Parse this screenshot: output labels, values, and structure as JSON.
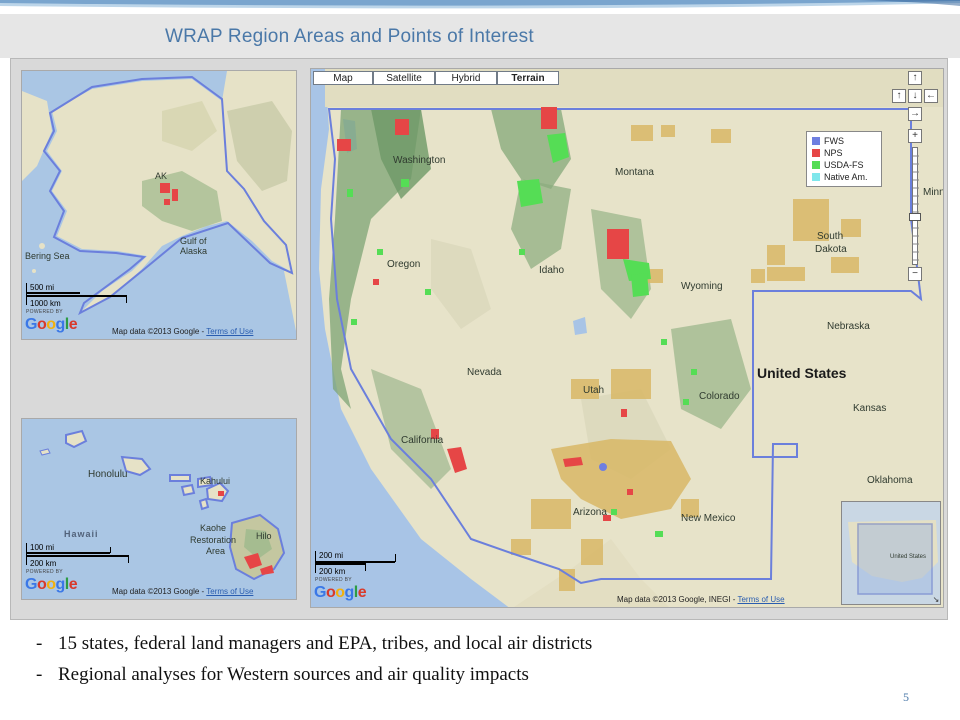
{
  "slide": {
    "title": "WRAP Region Areas and Points of Interest",
    "page_number": "5",
    "accent_color": "#4a78a8"
  },
  "bullets": [
    "15 states, federal land managers and EPA, tribes, and local air districts",
    "Regional analyses for Western sources and air quality impacts"
  ],
  "alaska_map": {
    "labels": {
      "ak": "AK",
      "bering_sea": "Bering Sea",
      "gulf_of_alaska": "Gulf of Alaska"
    },
    "scale": {
      "miles": "500 mi",
      "km": "1000 km"
    },
    "powered_by": "POWERED BY",
    "attribution": "Map data ©2013 Google - ",
    "terms": "Terms of Use"
  },
  "hawaii_map": {
    "labels": {
      "honolulu": "Honolulu",
      "hawaii": "Hawaii",
      "kahului": "Kahului",
      "kaohe": "Kaohe",
      "restoration": "Restoration",
      "area": "Area",
      "hilo": "Hilo"
    },
    "scale": {
      "miles": "100 mi",
      "km": "200 km"
    },
    "powered_by": "POWERED BY",
    "attribution": "Map data ©2013 Google - ",
    "terms": "Terms of Use"
  },
  "main_map": {
    "map_types": [
      "Map",
      "Satellite",
      "Hybrid",
      "Terrain"
    ],
    "active_map_type": "Terrain",
    "nav_controls": {
      "up": "↑",
      "left": "↑",
      "down": "↓",
      "right": "←",
      "rotate": "→",
      "zoom_in": "+",
      "zoom_out": "−"
    },
    "legend": [
      {
        "label": "FWS",
        "color": "#6f7fe0"
      },
      {
        "label": "NPS",
        "color": "#e64646"
      },
      {
        "label": "USDA-FS",
        "color": "#55dd55"
      },
      {
        "label": "Native Am.",
        "color": "#7fe7ec"
      }
    ],
    "labels": {
      "washington": "Washington",
      "montana": "Montana",
      "oregon": "Oregon",
      "idaho": "Idaho",
      "wyoming": "Wyoming",
      "south": "South",
      "dakota": "Dakota",
      "nebraska": "Nebraska",
      "nevada": "Nevada",
      "utah": "Utah",
      "colorado": "Colorado",
      "kansas": "Kansas",
      "california": "California",
      "arizona": "Arizona",
      "new_mexico": "New Mexico",
      "oklahoma": "Oklahoma",
      "minn": "Minn",
      "united_states": "United States",
      "inset_us": "United States"
    },
    "scale": {
      "miles": "200 mi",
      "km": "200 km"
    },
    "powered_by": "POWERED BY",
    "attribution": "Map data ©2013 Google, INEGI - ",
    "terms": "Terms of Use"
  },
  "colors": {
    "water": "#a8c4e6",
    "land": "#e7e3c9",
    "forest": "#7ea474",
    "boundary": "#6b7fdc",
    "orange_area": "#d8b766",
    "google_blue": "#3b78e7",
    "google_red": "#d93a2b",
    "google_yellow": "#f2b10f",
    "google_green": "#2d9c45"
  }
}
